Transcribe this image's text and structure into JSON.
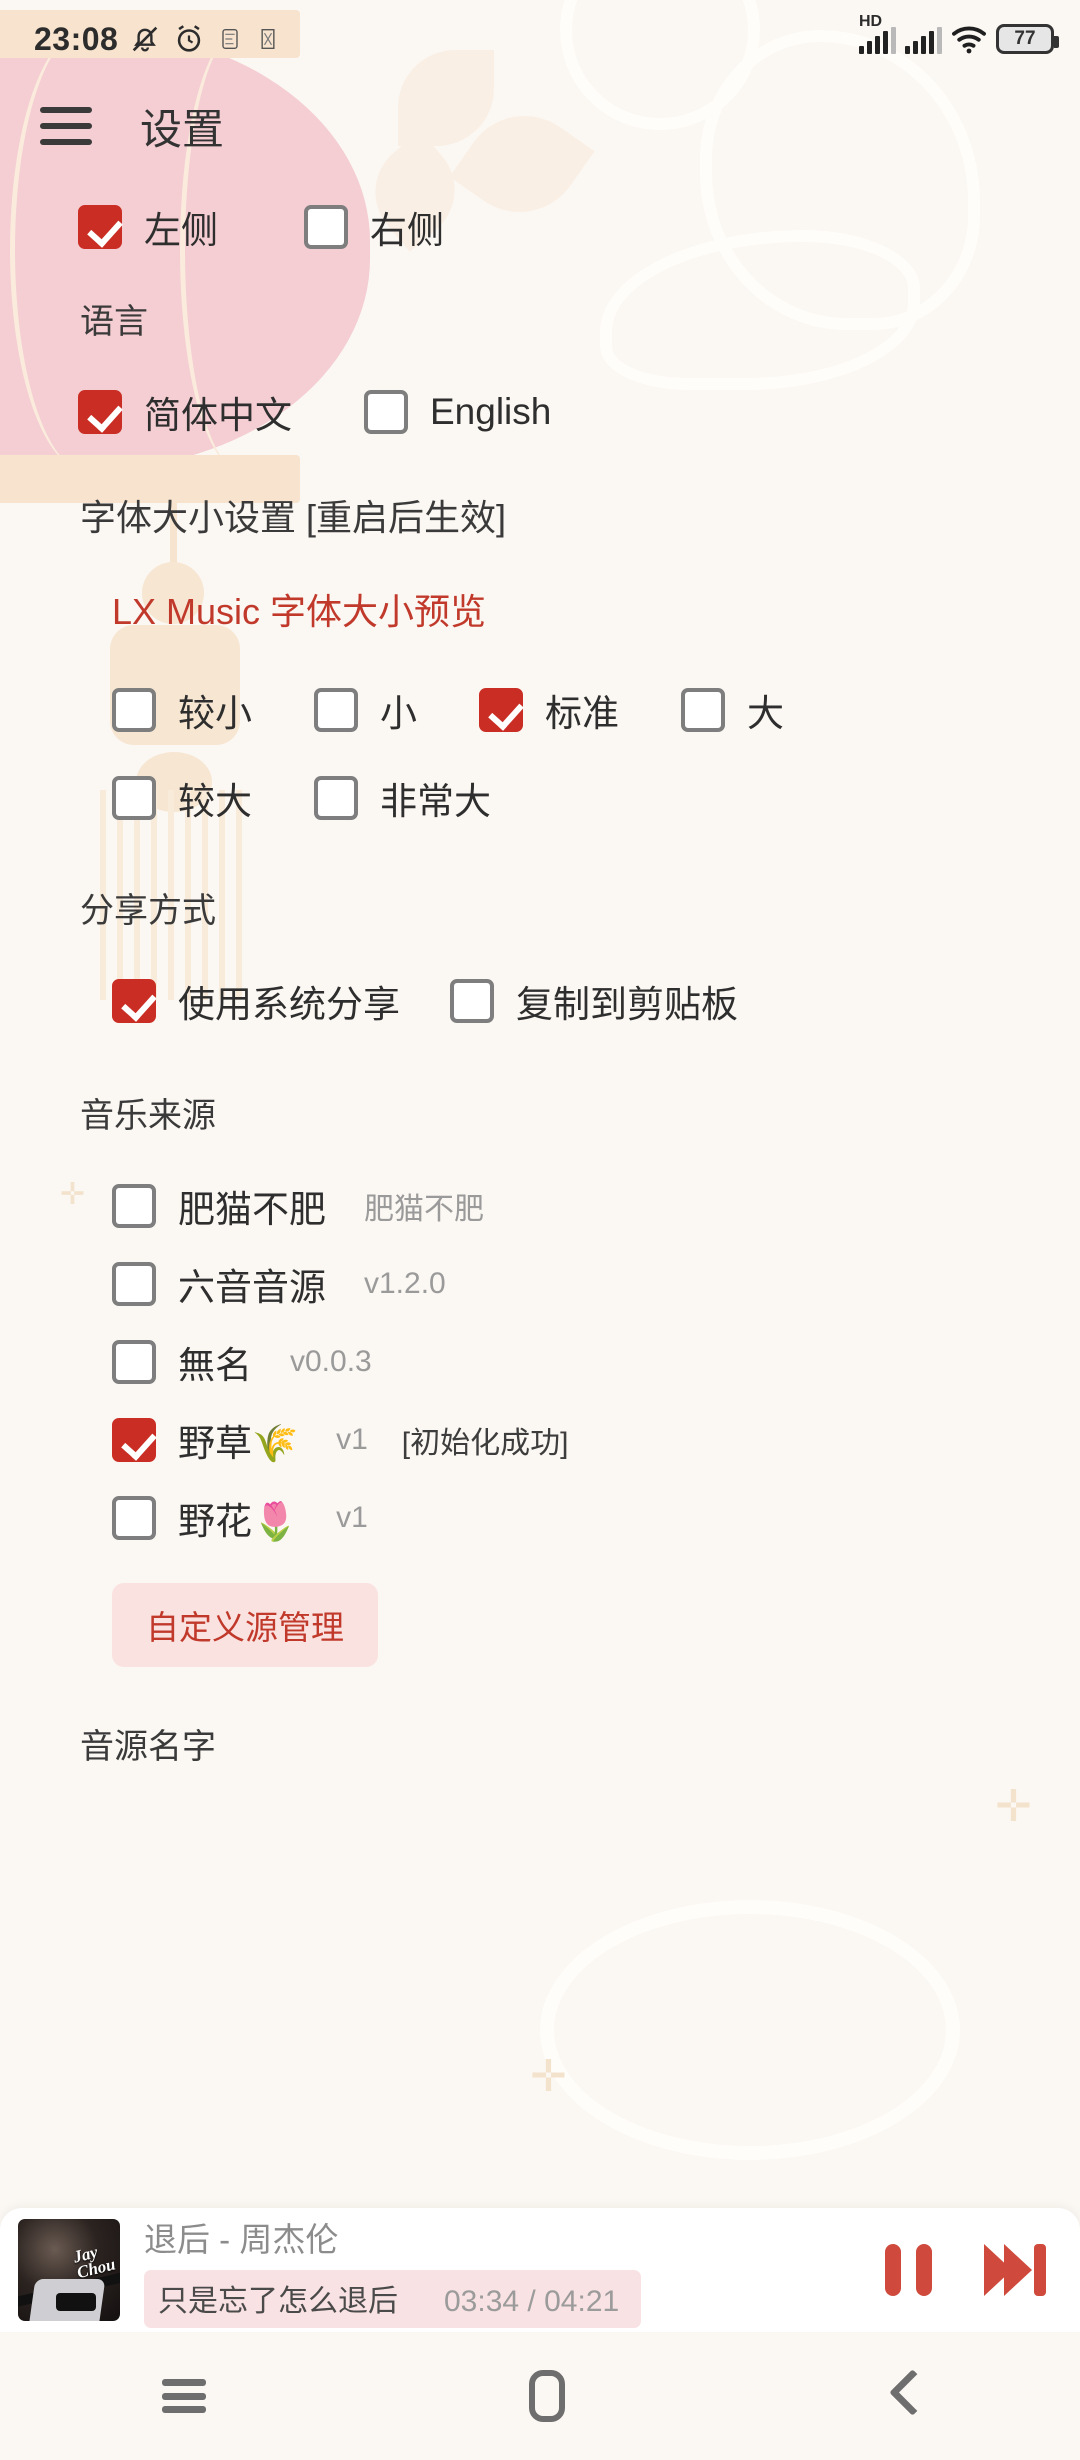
{
  "status_bar": {
    "time": "23:08",
    "battery_percent": "77",
    "hd_label": "HD",
    "icons": [
      "mute-bell-icon",
      "alarm-clock-icon",
      "app-notification-icon-1",
      "app-notification-icon-2",
      "hd-signal-icon",
      "signal-icon",
      "wifi-icon",
      "battery-icon"
    ]
  },
  "header": {
    "title": "设置",
    "menu_icon": "hamburger-menu-icon"
  },
  "sections": {
    "drawer_side": {
      "options": [
        {
          "label": "左侧",
          "checked": true
        },
        {
          "label": "右侧",
          "checked": false
        }
      ]
    },
    "language": {
      "title": "语言",
      "options": [
        {
          "label": "简体中文",
          "checked": true
        },
        {
          "label": "English",
          "checked": false
        }
      ]
    },
    "font_size": {
      "title": "字体大小设置 [重启后生效]",
      "preview_text": "LX Music 字体大小预览",
      "options_row1": [
        {
          "label": "较小",
          "checked": false
        },
        {
          "label": "小",
          "checked": false
        },
        {
          "label": "标准",
          "checked": true
        },
        {
          "label": "大",
          "checked": false
        }
      ],
      "options_row2": [
        {
          "label": "较大",
          "checked": false
        },
        {
          "label": "非常大",
          "checked": false
        }
      ]
    },
    "share_method": {
      "title": "分享方式",
      "options": [
        {
          "label": "使用系统分享",
          "checked": true
        },
        {
          "label": "复制到剪贴板",
          "checked": false
        }
      ]
    },
    "music_source": {
      "title": "音乐来源",
      "items": [
        {
          "label": "肥猫不肥",
          "meta": "肥猫不肥",
          "checked": false
        },
        {
          "label": "六音音源",
          "meta": "v1.2.0",
          "checked": false
        },
        {
          "label": "無名",
          "meta": "v0.0.3",
          "checked": false
        },
        {
          "label": "野草🌾",
          "meta": "v1",
          "meta2": "[初始化成功]",
          "checked": true
        },
        {
          "label": "野花🌷",
          "meta": "v1",
          "checked": false
        }
      ],
      "custom_source_button": "自定义源管理"
    },
    "source_name": {
      "title": "音源名字"
    }
  },
  "player": {
    "track_title": "退后 - 周杰伦",
    "lyric": "只是忘了怎么退后",
    "current_time": "03:34",
    "time_separator": "/",
    "total_time": "04:21",
    "pause_icon": "pause-icon",
    "next_icon": "next-track-icon",
    "album_art_alt": "album-art"
  },
  "nav_bar": {
    "recents_icon": "recents-icon",
    "home_icon": "home-icon",
    "back_icon": "back-icon"
  },
  "colors": {
    "accent_red": "#C92D24",
    "player_red": "#CF4A3C",
    "preview_red": "#C0392B",
    "background": "#FBF7F2",
    "lantern_pink": "#F4CED3",
    "lyric_bg": "#F9E2E3"
  }
}
